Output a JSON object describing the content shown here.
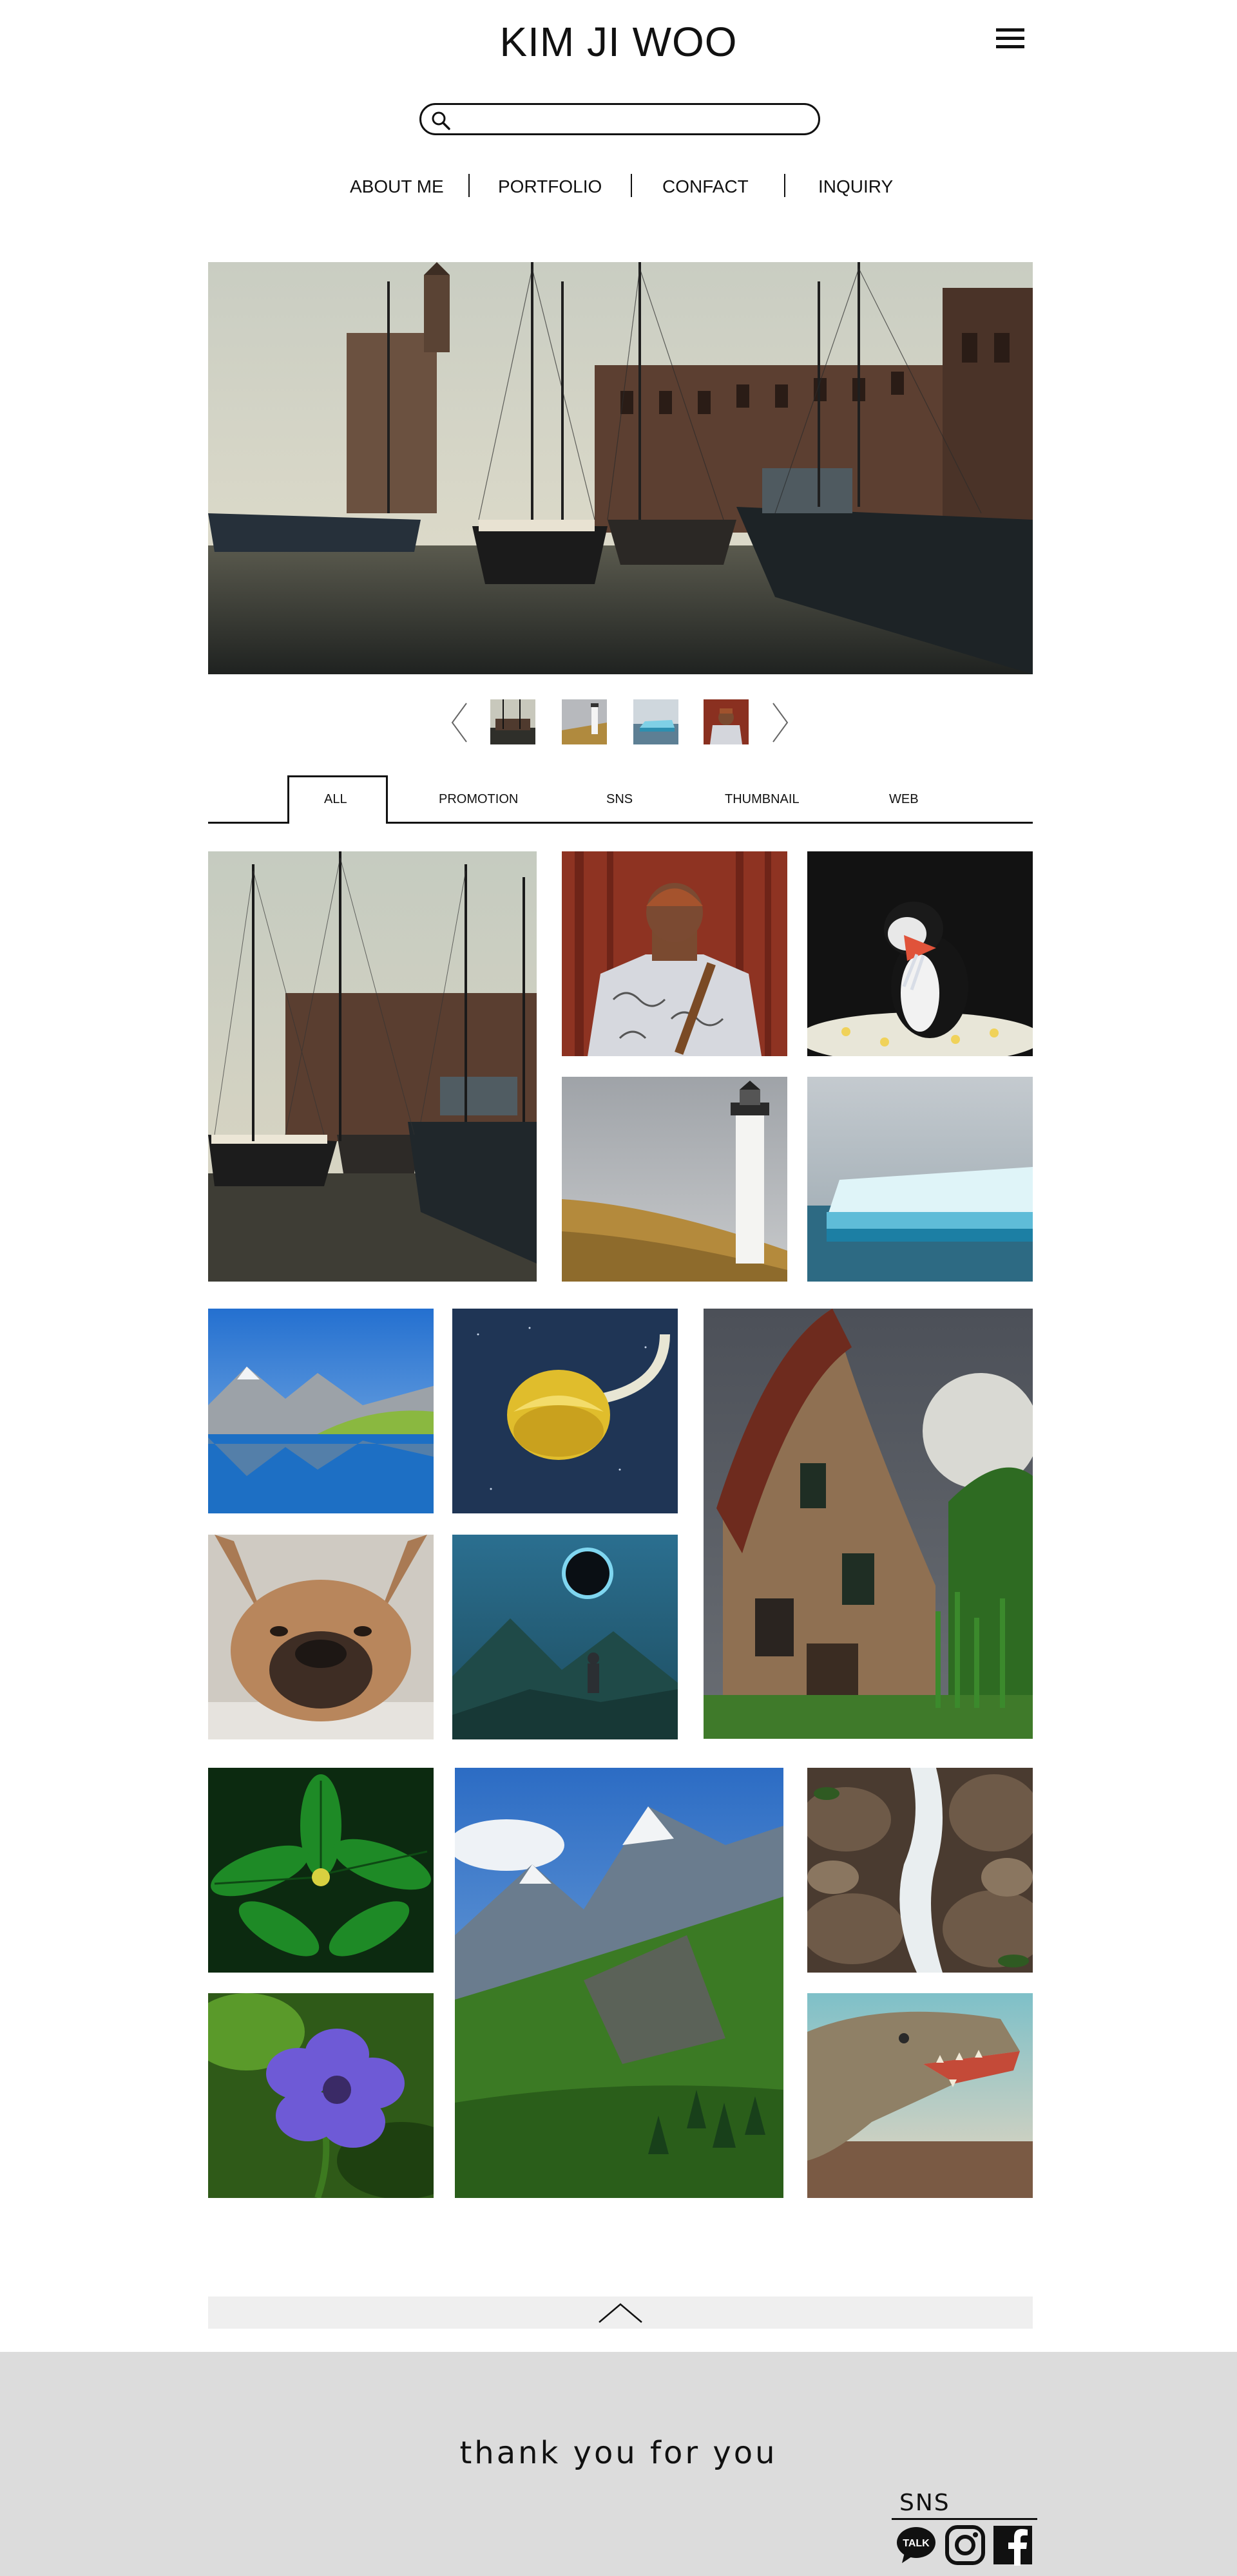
{
  "header": {
    "title": "KIM JI WOO",
    "menu_icon": "hamburger-menu-icon"
  },
  "search": {
    "placeholder": "",
    "value": "",
    "icon": "search-icon"
  },
  "nav": {
    "items": [
      {
        "label": "ABOUT ME"
      },
      {
        "label": "PORTFOLIO"
      },
      {
        "label": "CONFACT"
      },
      {
        "label": "INQUIRY"
      }
    ]
  },
  "hero": {
    "image": "harbor-with-sailing-ships",
    "prev_icon": "chevron-left-icon",
    "next_icon": "chevron-right-icon",
    "thumbnails": [
      {
        "image": "harbor-ships"
      },
      {
        "image": "lighthouse"
      },
      {
        "image": "iceberg"
      },
      {
        "image": "man-from-behind"
      }
    ]
  },
  "tabs": {
    "active": "ALL",
    "items": [
      {
        "label": "ALL"
      },
      {
        "label": "PROMOTION"
      },
      {
        "label": "SNS"
      },
      {
        "label": "THUMBNAIL"
      },
      {
        "label": "WEB"
      }
    ]
  },
  "gallery": {
    "images": [
      "harbor-ships",
      "man-in-patterned-shirt",
      "puffin-in-flowers",
      "lighthouse-on-hill",
      "iceberg-at-sea",
      "alpine-lake",
      "lemon-moon",
      "witch-house-under-moon",
      "french-bulldog",
      "person-under-eclipse",
      "green-leaves",
      "mountain-valley",
      "waterfall-on-rocks",
      "purple-geranium-flower",
      "dinosaur-roaring"
    ]
  },
  "back_to_top": {
    "icon": "chevron-up-icon"
  },
  "footer": {
    "text": "thank you for you",
    "sns_label": "SNS",
    "icons": [
      "kakaotalk-icon",
      "instagram-icon",
      "facebook-icon"
    ],
    "kakao_badge": "TALK"
  },
  "colors": {
    "text": "#111111",
    "footer_bg": "#dcdcdc",
    "top_bar_bg": "#efefef"
  }
}
